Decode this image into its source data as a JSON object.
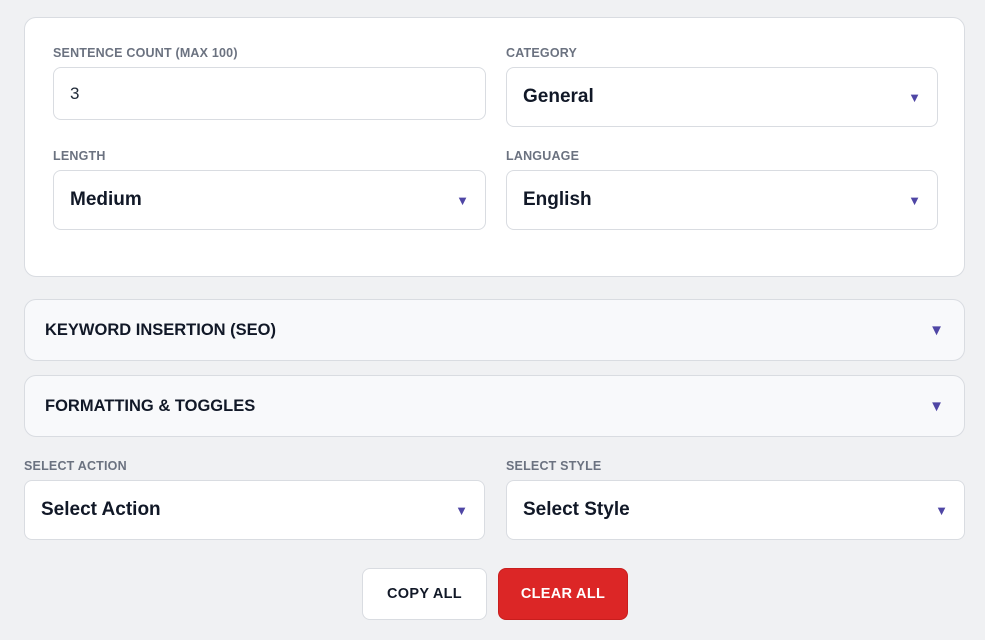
{
  "settings": {
    "sentence_count": {
      "label": "SENTENCE COUNT (MAX 100)",
      "value": "3"
    },
    "category": {
      "label": "CATEGORY",
      "value": "General"
    },
    "length": {
      "label": "LENGTH",
      "value": "Medium"
    },
    "language": {
      "label": "LANGUAGE",
      "value": "English"
    }
  },
  "accordions": [
    {
      "title": "KEYWORD INSERTION (SEO)"
    },
    {
      "title": "FORMATTING & TOGGLES"
    }
  ],
  "actions": {
    "action": {
      "label": "SELECT ACTION",
      "value": "Select Action"
    },
    "style": {
      "label": "SELECT STYLE",
      "value": "Select Style"
    }
  },
  "buttons": {
    "copy_label": "COPY ALL",
    "clear_label": "CLEAR ALL"
  },
  "icons": {
    "dropdown": "caret-down-icon"
  },
  "colors": {
    "accent": "#4f46a5",
    "danger": "#dc2626"
  }
}
